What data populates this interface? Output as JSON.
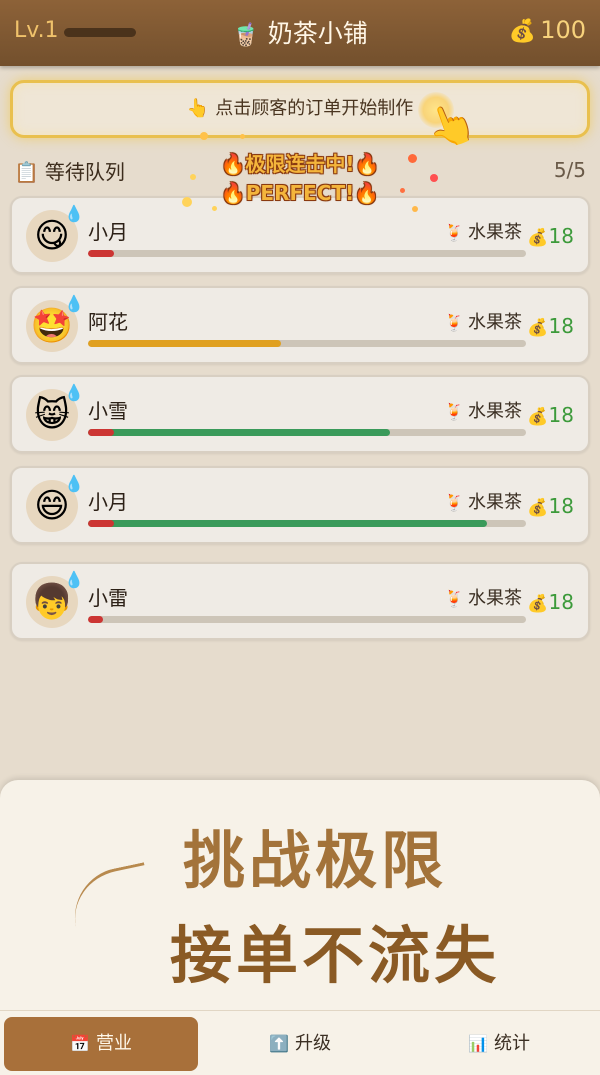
{
  "header": {
    "level": "Lv.1",
    "cup_icon": "🧋",
    "title": "奶茶小铺",
    "coin_icon": "💰",
    "coins": "100"
  },
  "tip": {
    "icon": "👆",
    "text": "点击顾客的订单开始制作",
    "hand_icon": "👆"
  },
  "queue": {
    "icon": "📋",
    "title": "等待队列",
    "count": "5/5"
  },
  "combo": {
    "line1": "🔥极限连击中!🔥",
    "line2": "🔥PERFECT!🔥"
  },
  "customers": [
    {
      "avatar": "😋",
      "sweat": "💧",
      "name": "小月",
      "drink_icon": "🍹",
      "drink": "水果茶",
      "bag": "💰",
      "reward": "18",
      "progress": 0.06,
      "color": "#cc3533"
    },
    {
      "avatar": "🤩",
      "sweat": "💧",
      "name": "阿花",
      "drink_icon": "🍹",
      "drink": "水果茶",
      "bag": "💰",
      "reward": "18",
      "progress": 0.44,
      "color": "#e0a020"
    },
    {
      "avatar": "😸",
      "sweat": "💧",
      "name": "小雪",
      "drink_icon": "🍹",
      "drink": "水果茶",
      "bag": "💰",
      "reward": "18",
      "progress": 0.69,
      "color": "#3a9a5a"
    },
    {
      "avatar": "😄",
      "sweat": "💧",
      "name": "小月",
      "drink_icon": "🍹",
      "drink": "水果茶",
      "bag": "💰",
      "reward": "18",
      "progress": 0.91,
      "color": "#3a9a5a"
    },
    {
      "avatar": "👦",
      "sweat": "💧",
      "name": "小雷",
      "drink_icon": "🍹",
      "drink": "水果茶",
      "bag": "💰",
      "reward": "18",
      "progress": 0.035,
      "color": "#cc3533"
    }
  ],
  "promo": {
    "line1": "挑战极限",
    "line2": "接单不流失"
  },
  "tabs": [
    {
      "icon": "📅",
      "label": "营业",
      "active": true
    },
    {
      "icon": "⬆️",
      "label": "升级",
      "active": false
    },
    {
      "icon": "📊",
      "label": "统计",
      "active": false
    }
  ]
}
